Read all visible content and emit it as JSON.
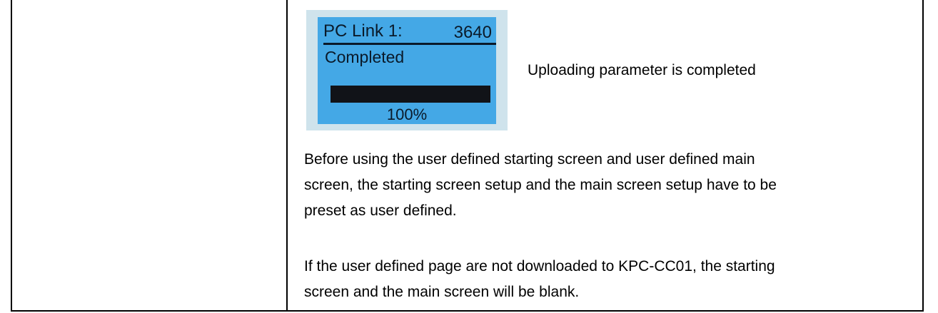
{
  "lcd": {
    "title": "PC Link 1:",
    "count": "3640",
    "status": "Completed",
    "progress_fraction": 1.0,
    "percent_label": "100%",
    "screen_color": "#44a8e6",
    "bezel_color": "#cfe3ec"
  },
  "caption": "Uploading parameter is completed",
  "paragraphs": [
    {
      "lines": [
        "Before using the user defined starting screen and user defined main",
        "screen, the starting screen setup and the main screen setup have to be",
        "preset as user defined."
      ]
    },
    {
      "lines": [
        "If the user defined page are not downloaded to KPC-CC01, the starting",
        "screen and the main screen will be blank."
      ]
    }
  ]
}
